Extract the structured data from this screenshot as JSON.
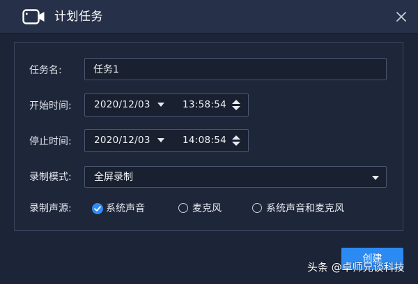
{
  "window": {
    "title": "计划任务",
    "title_icon": "video-camera-icon",
    "close_icon": "close-icon"
  },
  "form": {
    "task_name": {
      "label": "任务名:",
      "value": "任务1"
    },
    "start_time": {
      "label": "开始时间:",
      "date": "2020/12/03",
      "time": "13:58:54"
    },
    "stop_time": {
      "label": "停止时间:",
      "date": "2020/12/03",
      "time": "14:08:54"
    },
    "record_mode": {
      "label": "录制模式:",
      "selected": "全屏录制"
    },
    "audio_source": {
      "label": "录制声源:",
      "options": [
        {
          "label": "系统声音",
          "checked": true
        },
        {
          "label": "麦克风",
          "checked": false
        },
        {
          "label": "系统声音和麦克风",
          "checked": false
        }
      ]
    }
  },
  "actions": {
    "create_label": "创建"
  },
  "watermark": "头条 @卓师兄谈科技",
  "colors": {
    "accent": "#2c8af3",
    "background": "#1c2537",
    "titlebar": "#263048"
  }
}
